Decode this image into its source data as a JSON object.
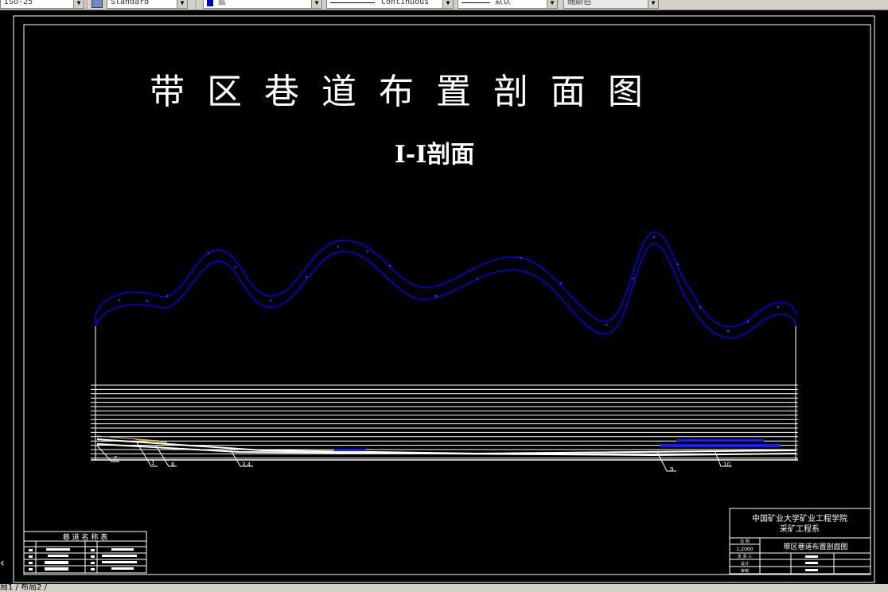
{
  "toolbar": {
    "dimstyle_value": "ISO-25",
    "textstyle_value": "Standard",
    "color_value": "蓝",
    "linetype_value": "Continuous",
    "lineweight_value": "默认",
    "plotstyle_value": "随颜色"
  },
  "drawing": {
    "title": "带  区  巷  道  布  置  剖  面  图",
    "section_title": "I-I剖面",
    "callouts": [
      "2",
      "1",
      "6",
      "3,4",
      "9",
      "10"
    ]
  },
  "title_block": {
    "institution": "中国矿业大学矿业工程学院",
    "department": "采矿工程系",
    "scale_label": "比 例",
    "scale_value": "1:2000",
    "drawing_name": "带区巷道布置剖面图",
    "row_label_1": "负 责 人",
    "row_label_2": "设计",
    "row_label_3": "审核"
  },
  "legend_table": {
    "title": "巷 道 名 称 表"
  },
  "layout_tabs": "局1 / 布局2 /",
  "colors": {
    "background": "#000000",
    "lines": "#ffffff",
    "strata": "#0000ff",
    "toolbar": "#d4d0c8"
  }
}
